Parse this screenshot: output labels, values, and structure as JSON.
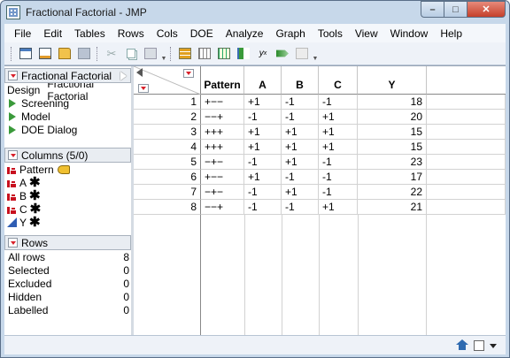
{
  "window": {
    "title": "Fractional Factorial - JMP"
  },
  "menu": [
    "File",
    "Edit",
    "Tables",
    "Rows",
    "Cols",
    "DOE",
    "Analyze",
    "Graph",
    "Tools",
    "View",
    "Window",
    "Help"
  ],
  "toolbar_icons": [
    "new-data-table-icon",
    "new-script-icon",
    "open-icon",
    "save-icon",
    "cut-icon",
    "copy-icon",
    "paste-icon",
    "data-table-icon",
    "formula-icon",
    "table-grid-icon",
    "distribution-icon",
    "fit-y-by-x-icon",
    "fit-model-icon",
    "graph-builder-icon"
  ],
  "table_panel": {
    "title": "Fractional Factorial",
    "design_label": "Design",
    "design_value": "Fractional Factorial",
    "scripts": [
      "Screening",
      "Model",
      "DOE Dialog"
    ]
  },
  "columns_panel": {
    "title": "Columns (5/0)",
    "columns": [
      {
        "name": "Pattern",
        "type": "nominal"
      },
      {
        "name": "A",
        "type": "nominal"
      },
      {
        "name": "B",
        "type": "nominal"
      },
      {
        "name": "C",
        "type": "nominal"
      },
      {
        "name": "Y",
        "type": "continuous"
      }
    ]
  },
  "rows_panel": {
    "title": "Rows",
    "items": [
      {
        "label": "All rows",
        "value": "8"
      },
      {
        "label": "Selected",
        "value": "0"
      },
      {
        "label": "Excluded",
        "value": "0"
      },
      {
        "label": "Hidden",
        "value": "0"
      },
      {
        "label": "Labelled",
        "value": "0"
      }
    ]
  },
  "table": {
    "headers": [
      "Pattern",
      "A",
      "B",
      "C",
      "Y"
    ],
    "rows": [
      {
        "n": "1",
        "pattern": "+−−",
        "a": "+1",
        "b": "-1",
        "c": "-1",
        "y": "18"
      },
      {
        "n": "2",
        "pattern": "−−+",
        "a": "-1",
        "b": "-1",
        "c": "+1",
        "y": "20"
      },
      {
        "n": "3",
        "pattern": "+++",
        "a": "+1",
        "b": "+1",
        "c": "+1",
        "y": "15"
      },
      {
        "n": "4",
        "pattern": "+++",
        "a": "+1",
        "b": "+1",
        "c": "+1",
        "y": "15"
      },
      {
        "n": "5",
        "pattern": "−+−",
        "a": "-1",
        "b": "+1",
        "c": "-1",
        "y": "23"
      },
      {
        "n": "6",
        "pattern": "+−−",
        "a": "+1",
        "b": "-1",
        "c": "-1",
        "y": "17"
      },
      {
        "n": "7",
        "pattern": "−+−",
        "a": "-1",
        "b": "+1",
        "c": "-1",
        "y": "22"
      },
      {
        "n": "8",
        "pattern": "−−+",
        "a": "-1",
        "b": "-1",
        "c": "+1",
        "y": "21"
      }
    ]
  }
}
